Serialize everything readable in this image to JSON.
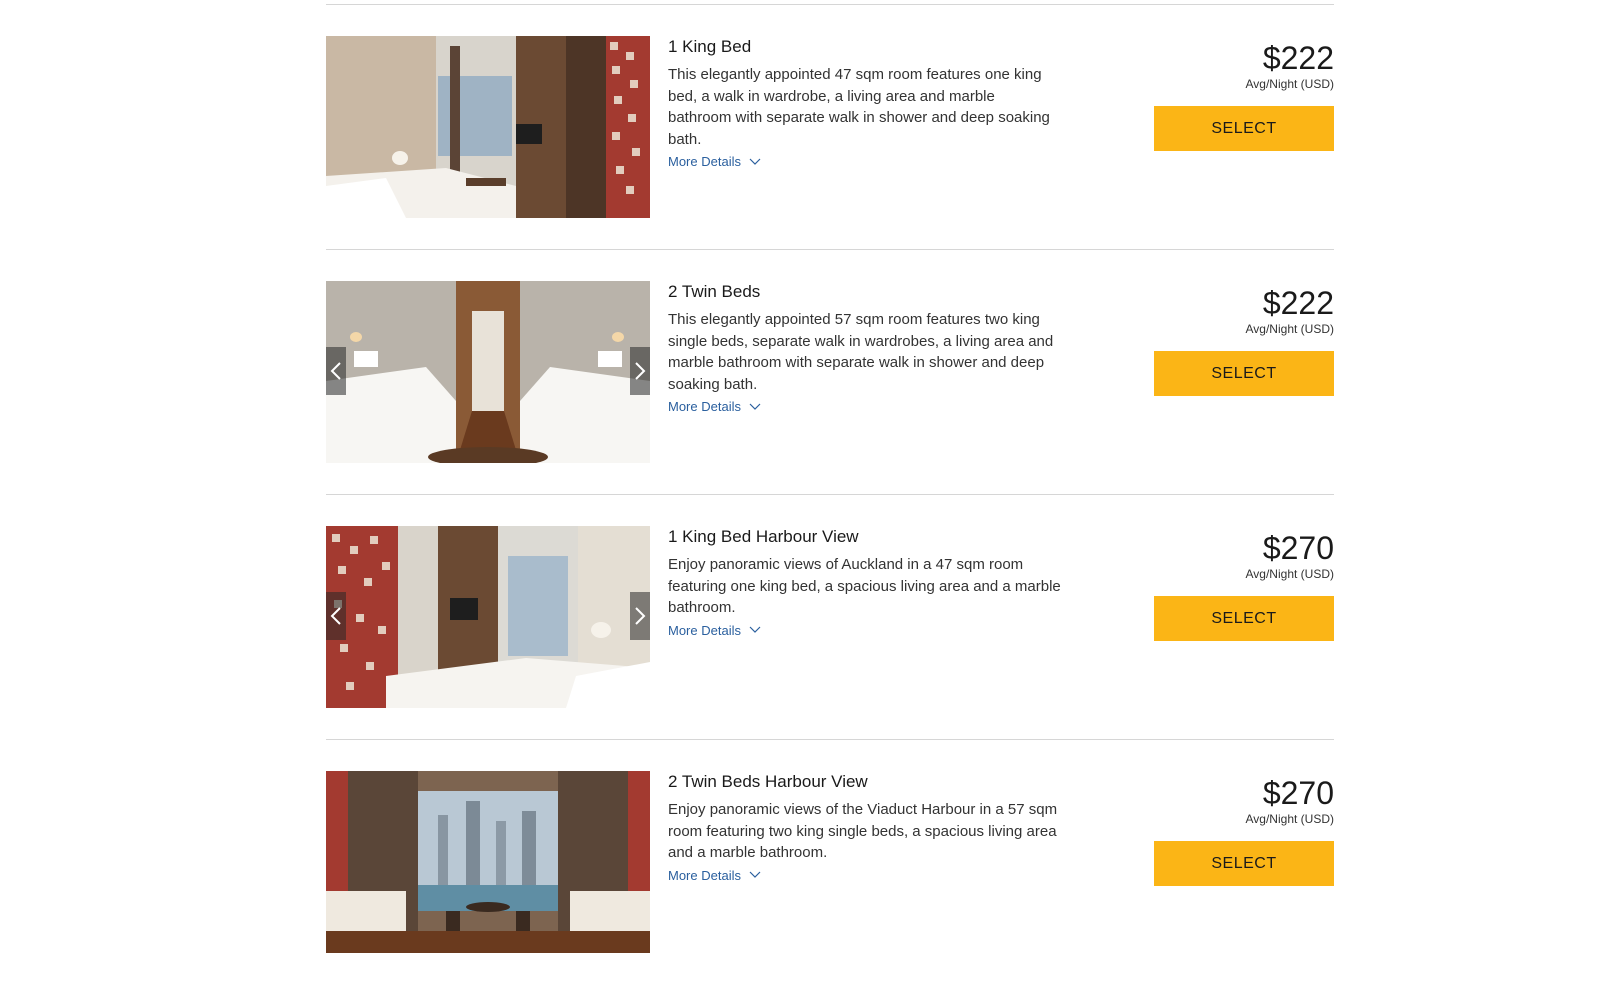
{
  "rooms": [
    {
      "title": "1 King Bed",
      "description": "This elegantly appointed 47 sqm room features one king bed, a walk in wardrobe, a living area and marble bathroom with separate walk in shower and deep soaking bath.",
      "more_details_label": "More Details",
      "price": "$222",
      "price_label": "Avg/Night (USD)",
      "select_label": "SELECT"
    },
    {
      "title": "2 Twin Beds",
      "description": "This elegantly appointed 57 sqm room features two king single beds, separate walk in wardrobes, a living area and marble bathroom with separate walk in shower and deep soaking bath.",
      "more_details_label": "More Details",
      "price": "$222",
      "price_label": "Avg/Night (USD)",
      "select_label": "SELECT"
    },
    {
      "title": "1 King Bed Harbour View",
      "description": "Enjoy panoramic views of Auckland in a 47 sqm room featuring one king bed, a spacious living area and a marble bathroom.",
      "more_details_label": "More Details",
      "price": "$270",
      "price_label": "Avg/Night (USD)",
      "select_label": "SELECT"
    },
    {
      "title": "2 Twin Beds Harbour View",
      "description": "Enjoy panoramic views of the Viaduct Harbour in a 57 sqm room featuring two king single beds, a spacious living area and a marble bathroom.",
      "more_details_label": "More Details",
      "price": "$270",
      "price_label": "Avg/Night (USD)",
      "select_label": "SELECT"
    }
  ],
  "colors": {
    "select_button": "#fbb516",
    "link": "#2a5f9e",
    "divider": "#d6d6d6"
  },
  "icons": {
    "carousel_prev": "chevron-left-icon",
    "carousel_next": "chevron-right-icon",
    "more_details": "chevron-down-icon"
  }
}
